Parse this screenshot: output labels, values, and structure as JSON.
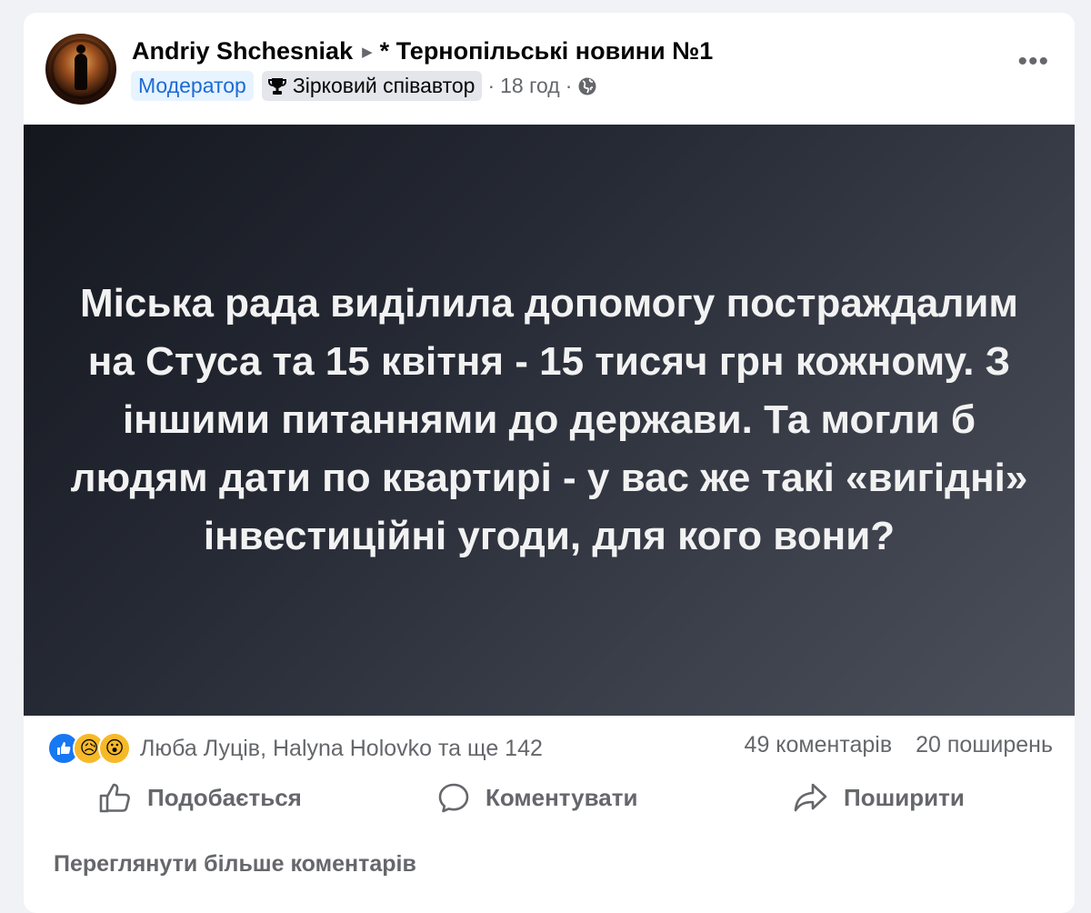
{
  "post": {
    "author": "Andriy Shchesniak",
    "group": "* Тернопільські новини №1",
    "badges": {
      "moderator": "Модератор",
      "star": "Зірковий співавтор"
    },
    "time": "18 год",
    "separator": "·",
    "more_label": "•••",
    "image_text": "Міська рада виділила допомогу постраждалим на Стуса та 15 квітня - 15 тисяч грн кожному. З іншими питаннями до держави. Та могли б людям дати по квартирі - у вас же такі «вигідні» інвестиційні угоди, для кого вони?"
  },
  "reactions": {
    "icons": [
      "like-icon",
      "sad-icon",
      "wow-icon"
    ],
    "sad_emoji": "😥",
    "wow_emoji": "😮",
    "names": "Люба Луців, Halyna Holovko та ще 142",
    "comments": "49 коментарів",
    "shares": "20 поширень"
  },
  "actions": {
    "like": "Подобається",
    "comment": "Коментувати",
    "share": "Поширити"
  },
  "view_more_comments": "Переглянути більше коментарів",
  "colors": {
    "accent": "#1877f2",
    "muted": "#65676b",
    "badge_bg": "#e7f3ff"
  }
}
